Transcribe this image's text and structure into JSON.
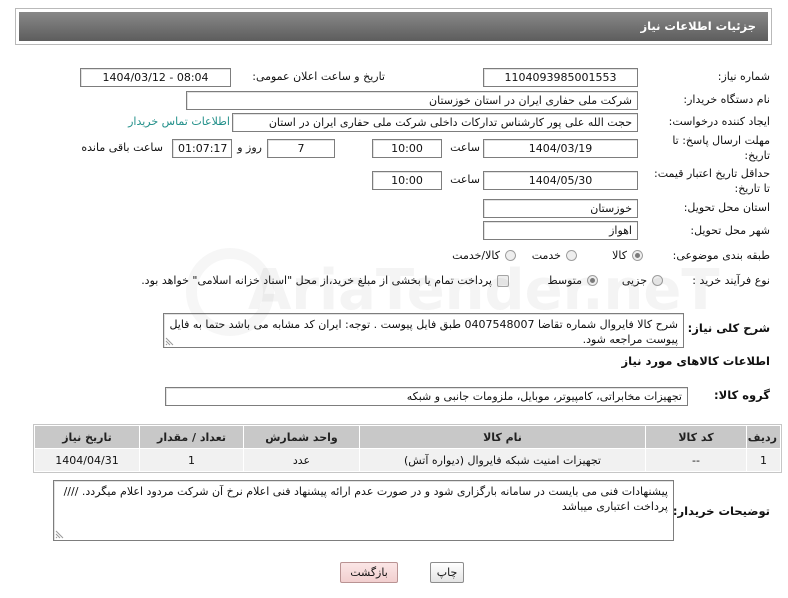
{
  "page": {
    "title": "جزئیات اطلاعات نیاز"
  },
  "fields": {
    "need_number": {
      "label": "شماره نیاز:",
      "value": "1104093985001553"
    },
    "announce_datetime": {
      "label": "تاریخ و ساعت اعلان عمومی:",
      "value": "1404/03/12 - 08:04"
    },
    "buyer_org": {
      "label": "نام دستگاه خریدار:",
      "value": "شرکت ملی حفاری ایران در استان خوزستان"
    },
    "requester": {
      "label": "ایجاد کننده درخواست:",
      "value": "حجت الله علی پور کارشناس تدارکات داخلی شرکت ملی حفاری ایران در استان",
      "contact_link": "اطلاعات تماس خریدار"
    },
    "reply_deadline": {
      "label_line1": "مهلت ارسال پاسخ: تا",
      "label_line2": "تاریخ:",
      "date": "1404/03/19",
      "time_label": "ساعت",
      "time": "10:00",
      "days": "7",
      "days_label": "روز و",
      "remaining": "01:07:17",
      "remaining_label": "ساعت باقی مانده"
    },
    "price_validity": {
      "label_line1": "حداقل تاریخ اعتبار قیمت:",
      "label_line2": "تا تاریخ:",
      "date": "1404/05/30",
      "time_label": "ساعت",
      "time": "10:00"
    },
    "delivery_province": {
      "label": "استان محل تحویل:",
      "value": "خوزستان"
    },
    "delivery_city": {
      "label": "شهر محل تحویل:",
      "value": "اهواز"
    },
    "category": {
      "label": "طبقه بندی موضوعی:",
      "options": [
        {
          "label": "کالا",
          "checked": true
        },
        {
          "label": "خدمت",
          "checked": false
        },
        {
          "label": "کالا/خدمت",
          "checked": false
        }
      ]
    },
    "process_type": {
      "label": "نوع فرآیند خرید :",
      "options": [
        {
          "label": "جزیی",
          "checked": false
        },
        {
          "label": "متوسط",
          "checked": true
        }
      ],
      "treasury_checkbox": {
        "label": "پرداخت تمام یا بخشی از مبلغ خرید،از محل \"اسناد خزانه اسلامی\" خواهد بود.",
        "checked": false
      }
    }
  },
  "description": {
    "label": "شرح کلی نیاز:",
    "value": "شرح کالا فایروال شماره تقاضا 0407548007 طبق فایل پیوست . توجه: ایران کد مشابه می باشد حتما به فایل پیوست مراجعه شود."
  },
  "items_section": {
    "heading": "اطلاعات کالاهای مورد نیاز",
    "group_label": "گروه کالا:",
    "group_value": "تجهیزات مخابراتی، کامپیوتر، موبایل، ملزومات جانبی و شبکه",
    "table": {
      "columns": [
        "ردیف",
        "کد کالا",
        "نام کالا",
        "واحد شمارش",
        "تعداد / مقدار",
        "تاریخ نیاز"
      ],
      "rows": [
        {
          "row_number": "1",
          "item_code": "--",
          "item_name": "تجهیزات امنیت شبکه فایروال (دیواره آتش)",
          "unit": "عدد",
          "quantity": "1",
          "need_date": "1404/04/31"
        }
      ]
    }
  },
  "buyer_notes": {
    "label": "توضیحات خریدار:",
    "value": "پیشنهادات فنی می بایست در سامانه بارگزاری شود و در صورت عدم ارائه پیشنهاد فنی اعلام نرخ آن شرکت مردود اعلام میگردد.  //// پرداخت اعتباری میباشد"
  },
  "buttons": {
    "print": "چاپ",
    "back": "بازگشت"
  },
  "watermark": "AriaTender.neT",
  "colors": {
    "header_bg": "#5d5d5d",
    "link": "#23908a",
    "back_button_bg": "#f2cfcf"
  }
}
